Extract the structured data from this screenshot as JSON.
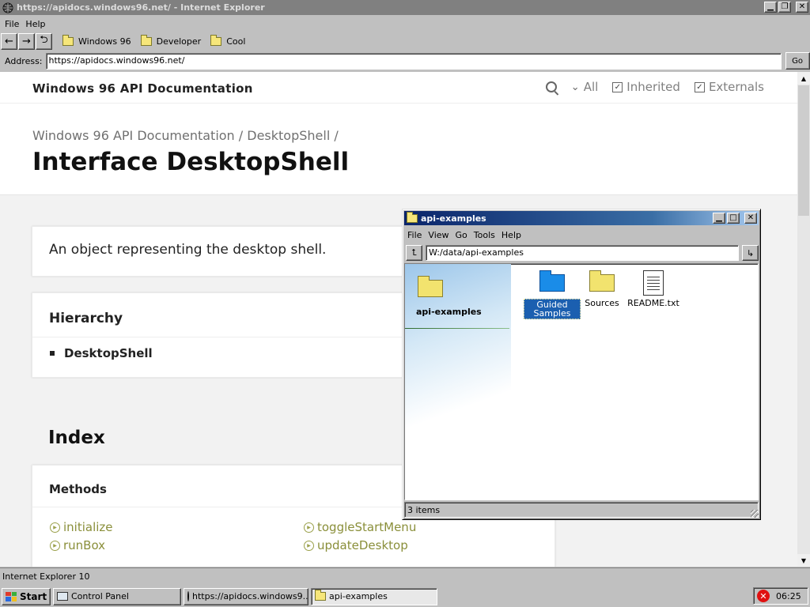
{
  "ie": {
    "title": "https://apidocs.windows96.net/ - Internet Explorer",
    "menu": [
      "File",
      "Help"
    ],
    "nav": {
      "back": "←",
      "forward": "→",
      "refresh": "⮌"
    },
    "favorites": [
      "Windows 96",
      "Developer",
      "Cool"
    ],
    "address_label": "Address:",
    "address_value": "https://apidocs.windows96.net/",
    "go_label": "Go",
    "status": "Internet Explorer 10"
  },
  "doc": {
    "site_name": "Windows 96 API Documentation",
    "tools": {
      "all": "All",
      "inherited": "Inherited",
      "externals": "Externals"
    },
    "breadcrumb": "Windows 96 API Documentation / DesktopShell /",
    "title": "Interface DesktopShell",
    "description": "An object representing the desktop shell.",
    "hierarchy_title": "Hierarchy",
    "hierarchy_item": "DesktopShell",
    "index_title": "Index",
    "methods_title": "Methods",
    "methods": [
      "initialize",
      "runBox",
      "toggleStartMenu",
      "updateDesktop"
    ]
  },
  "explorer": {
    "title": "api-examples",
    "menu": [
      "File",
      "View",
      "Go",
      "Tools",
      "Help"
    ],
    "path": "W:/data/api-examples",
    "sidebar_title": "api-examples",
    "items": [
      {
        "label": "Guided Samples",
        "icon": "folder-blue",
        "selected": true
      },
      {
        "label": "Sources",
        "icon": "folder"
      },
      {
        "label": "README.txt",
        "icon": "text-file"
      }
    ],
    "status": "3 items"
  },
  "taskbar": {
    "start": "Start",
    "tasks": [
      "Control Panel",
      "https://apidocs.windows9...",
      "api-examples"
    ],
    "clock": "06:25"
  },
  "colors": {
    "accent": "#0a246a",
    "method_link": "#8a8f3a",
    "error_icon": "#e01010"
  }
}
